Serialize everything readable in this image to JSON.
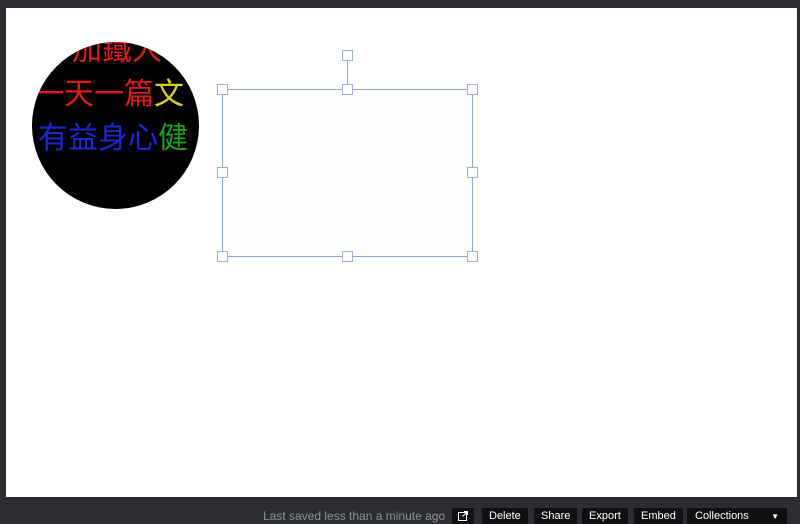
{
  "canvas": {
    "circle_text": {
      "line1": [
        {
          "text": "加鐵人",
          "color": "#e01818"
        }
      ],
      "line2": [
        {
          "text": "一天一篇",
          "color": "#e01818"
        },
        {
          "text": "文",
          "color": "#d8d020"
        }
      ],
      "line3": [
        {
          "text": "有益身心",
          "color": "#1c28d8"
        },
        {
          "text": "健",
          "color": "#18a018"
        }
      ]
    }
  },
  "footer": {
    "status_text": "Last saved less than a minute ago",
    "delete_label": "Delete",
    "share_label": "Share",
    "export_label": "Export",
    "embed_label": "Embed",
    "collections_label": "Collections",
    "collections_arrow": "▼"
  },
  "icons": {
    "open_icon": "external-link-icon",
    "dropdown_icon": "chevron-down-icon"
  }
}
